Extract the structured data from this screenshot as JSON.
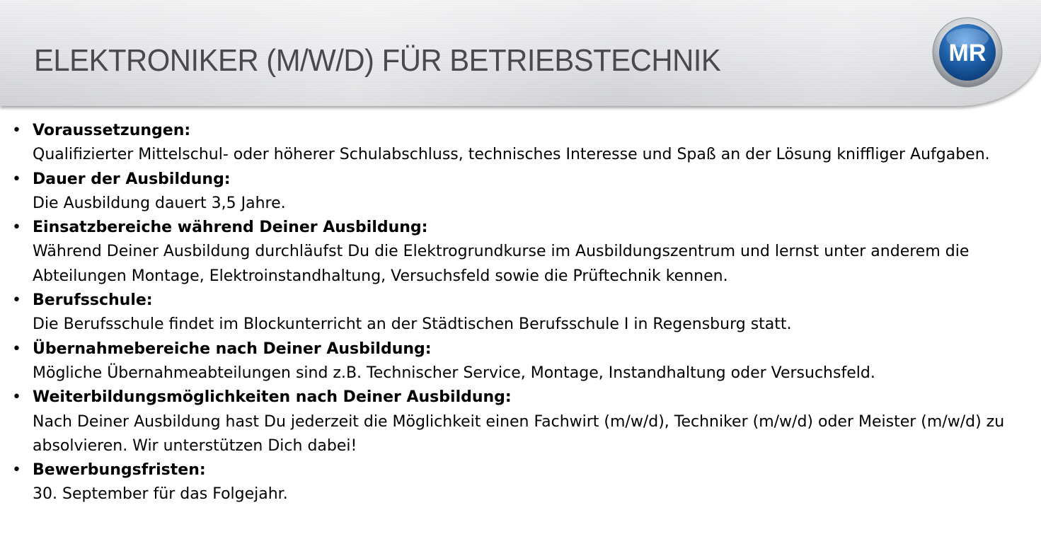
{
  "header": {
    "title": "ELEKTRONIKER (M/W/D) FÜR BETRIEBSTECHNIK",
    "logo_text": "MR",
    "logo_icon": "mr-logo-icon"
  },
  "colors": {
    "title_text": "#4a4a4c",
    "logo_blue": "#1e5fa8",
    "body_text": "#000000"
  },
  "items": [
    {
      "label": "Voraussetzungen:",
      "text": "Qualifizierter Mittelschul- oder höherer Schulabschluss, technisches Interesse und Spaß an der Lösung kniffliger Aufgaben."
    },
    {
      "label": "Dauer der Ausbildung:",
      "text": "Die Ausbildung dauert 3,5 Jahre."
    },
    {
      "label": "Einsatzbereiche während Deiner Ausbildung:",
      "text": "Während Deiner Ausbildung durchläufst Du die Elektrogrundkurse im Ausbildungszentrum und lernst unter anderem die Abteilungen Montage, Elektroinstandhaltung, Versuchsfeld sowie die Prüftechnik kennen."
    },
    {
      "label": "Berufsschule:",
      "text": "Die Berufsschule findet im Blockunterricht an der Städtischen Berufsschule I in Regensburg statt."
    },
    {
      "label": "Übernahmebereiche nach Deiner Ausbildung:",
      "text": "Mögliche Übernahmeabteilungen sind z.B. Technischer Service, Montage, Instandhaltung oder Versuchsfeld."
    },
    {
      "label": "Weiterbildungsmöglichkeiten nach Deiner Ausbildung:",
      "text": "Nach Deiner Ausbildung hast Du jederzeit die Möglichkeit einen Fachwirt (m/w/d), Techniker (m/w/d) oder Meister (m/w/d) zu absolvieren. Wir unterstützen Dich dabei!"
    },
    {
      "label": "Bewerbungsfristen:",
      "text": "30. September für das Folgejahr."
    }
  ]
}
